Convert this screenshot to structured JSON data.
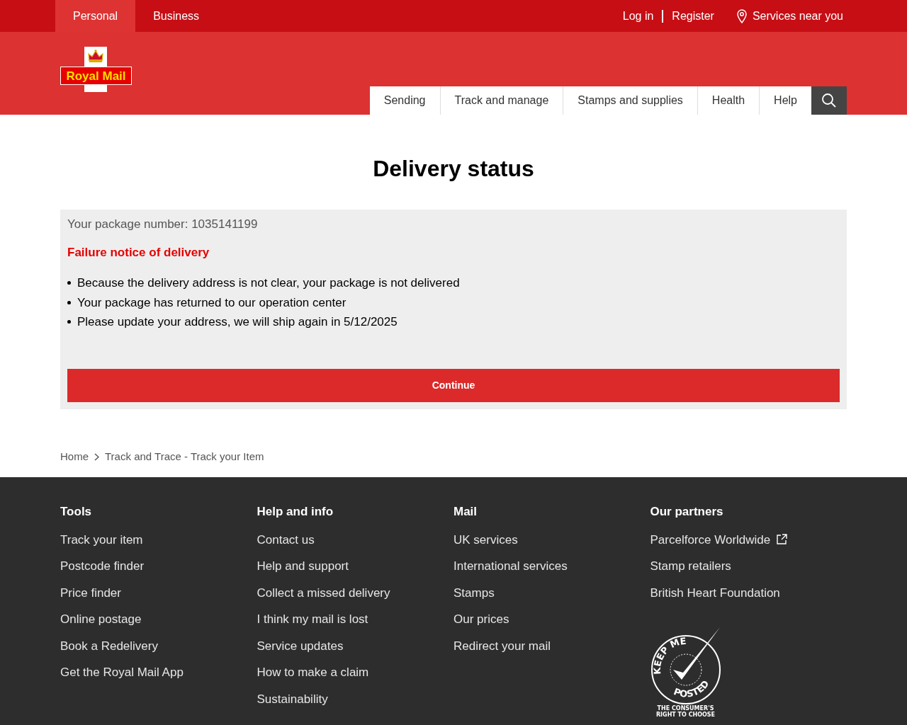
{
  "top_bar": {
    "tabs": [
      {
        "label": "Personal",
        "selected": true
      },
      {
        "label": "Business",
        "selected": false
      }
    ],
    "account_links": [
      "Log in",
      "Register"
    ],
    "services_link": "Services near you"
  },
  "logo": {
    "text": "Royal Mail"
  },
  "nav": {
    "items": [
      "Sending",
      "Track and manage",
      "Stamps and supplies",
      "Health",
      "Help"
    ]
  },
  "title": "Delivery status",
  "status_box": {
    "package_line": "Your package number: 1035141199",
    "notice": "Failure notice of delivery",
    "bullets": [
      "Because the delivery address is not clear, your package is not delivered",
      "Your package has returned to our operation center",
      "Please update your address, we will ship again in 5/12/2025"
    ],
    "button": "Continue"
  },
  "breadcrumb": [
    "Home",
    "Track and Trace - Track your Item"
  ],
  "footer": {
    "columns": [
      {
        "heading": "Tools",
        "links": [
          {
            "label": "Track your item",
            "external": false
          },
          {
            "label": "Postcode finder",
            "external": false
          },
          {
            "label": "Price finder",
            "external": false
          },
          {
            "label": "Online postage",
            "external": false
          },
          {
            "label": "Book a Redelivery",
            "external": false
          },
          {
            "label": "Get the Royal Mail App",
            "external": false
          }
        ]
      },
      {
        "heading": "Help and info",
        "links": [
          {
            "label": "Contact us",
            "external": false
          },
          {
            "label": "Help and support",
            "external": false
          },
          {
            "label": "Collect a missed delivery",
            "external": false
          },
          {
            "label": "I think my mail is lost",
            "external": false
          },
          {
            "label": "Service updates",
            "external": false
          },
          {
            "label": "How to make a claim",
            "external": false
          },
          {
            "label": "Sustainability",
            "external": false
          }
        ]
      },
      {
        "heading": "Mail",
        "links": [
          {
            "label": "UK services",
            "external": false
          },
          {
            "label": "International services",
            "external": false
          },
          {
            "label": "Stamps",
            "external": false
          },
          {
            "label": "Our prices",
            "external": false
          },
          {
            "label": "Redirect your mail",
            "external": false
          }
        ]
      },
      {
        "heading": "Our partners",
        "links": [
          {
            "label": "Parcelforce Worldwide",
            "external": true
          },
          {
            "label": "Stamp retailers",
            "external": false
          },
          {
            "label": "British Heart Foundation",
            "external": false
          }
        ]
      }
    ],
    "badge": {
      "arc_top": "KEEP ME",
      "arc_bottom": "POSTED",
      "caption": [
        "THE CONSUMER'S",
        "RIGHT TO CHOOSE"
      ]
    }
  }
}
